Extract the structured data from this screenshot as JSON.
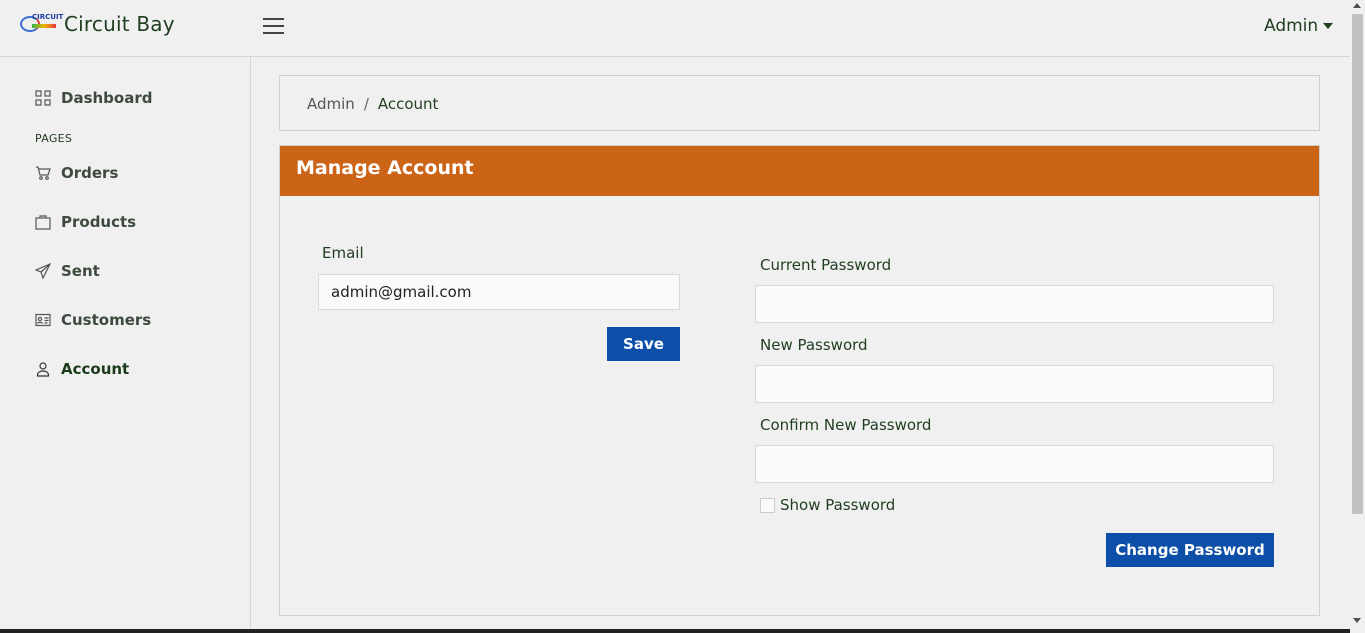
{
  "brand": {
    "name": "Circuit Bay",
    "logo_text": "CIRCUIT"
  },
  "header": {
    "user_menu": "Admin"
  },
  "sidebar": {
    "section_label": "PAGES",
    "items": [
      {
        "label": "Dashboard",
        "icon": "grid-icon"
      },
      {
        "label": "Orders",
        "icon": "cart-icon"
      },
      {
        "label": "Products",
        "icon": "bag-icon"
      },
      {
        "label": "Sent",
        "icon": "send-icon"
      },
      {
        "label": "Customers",
        "icon": "id-card-icon"
      },
      {
        "label": "Account",
        "icon": "user-icon"
      }
    ]
  },
  "breadcrumb": {
    "parent": "Admin",
    "separator": "/",
    "current": "Account"
  },
  "card": {
    "title": "Manage Account"
  },
  "email_form": {
    "label": "Email",
    "value": "admin@gmail.com",
    "save_label": "Save"
  },
  "password_form": {
    "current_label": "Current Password",
    "new_label": "New Password",
    "confirm_label": "Confirm New Password",
    "show_label": "Show Password",
    "submit_label": "Change Password"
  },
  "colors": {
    "accent": "#cc6418",
    "button": "#0d4fa8",
    "background": "#f0f0f0"
  }
}
